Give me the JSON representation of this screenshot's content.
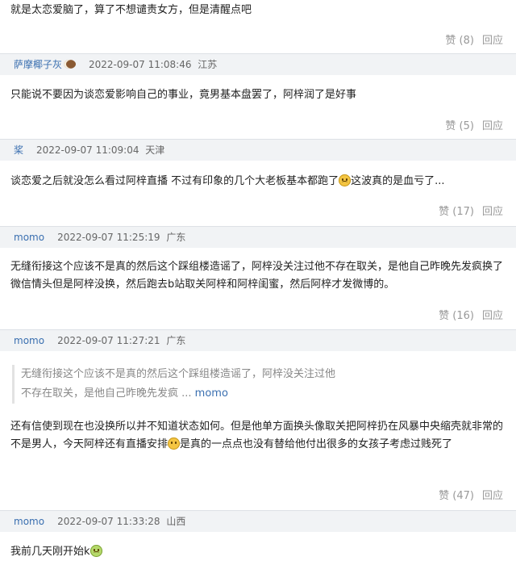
{
  "comments": [
    {
      "text": "就是太恋爱脑了，算了不想谴责女方，但是清醒点吧",
      "like_label": "赞 (8)",
      "reply_label": "回应"
    },
    {
      "user": "萨摩椰子灰",
      "time": "2022-09-07 11:08:46",
      "location": "江苏",
      "text": "只能说不要因为谈恋爱影响自己的事业，竟男基本盘罢了，阿梓润了是好事",
      "like_label": "赞 (5)",
      "reply_label": "回应"
    },
    {
      "user": "桨",
      "time": "2022-09-07 11:09:04",
      "location": "天津",
      "text_before": "谈恋爱之后就没怎么看过阿梓直播 不过有印象的几个大老板基本都跑了",
      "text_after": "这波真的是血亏了...",
      "like_label": "赞 (17)",
      "reply_label": "回应"
    },
    {
      "user": "momo",
      "time": "2022-09-07 11:25:19",
      "location": "广东",
      "text": "无缝衔接这个应该不是真的然后这个踩组楼造谣了，阿梓没关注过他不存在取关，是他自己昨晚先发疯换了微信情头但是阿梓没换，然后跑去b站取关阿梓和阿梓闺蜜，然后阿梓才发微博的。",
      "like_label": "赞 (16)",
      "reply_label": "回应"
    },
    {
      "user": "momo",
      "time": "2022-09-07 11:27:21",
      "location": "广东",
      "quote_line1": "无缝衔接这个应该不是真的然后这个踩组楼造谣了，阿梓没关注过他",
      "quote_line2": "不存在取关，是他自己昨晚先发疯 ...",
      "quote_author": "momo",
      "text_before": "还有信使到现在也没换所以并不知道状态如何。但是他单方面换头像取关把阿梓扔在风暴中央缩壳就非常的不是男人，今天阿梓还有直播安排",
      "text_after": "是真的一点点也没有替给他付出很多的女孩子考虑过贱死了",
      "like_label": "赞 (47)",
      "reply_label": "回应"
    },
    {
      "user": "momo",
      "time": "2022-09-07 11:33:28",
      "location": "山西",
      "text": "我前几天刚开始k"
    }
  ],
  "icons": {
    "coconut": "coconut-icon",
    "sad_face": "sad-face-emoji",
    "grin_face": "grin-face-emoji",
    "sick_face": "sick-face-emoji"
  }
}
